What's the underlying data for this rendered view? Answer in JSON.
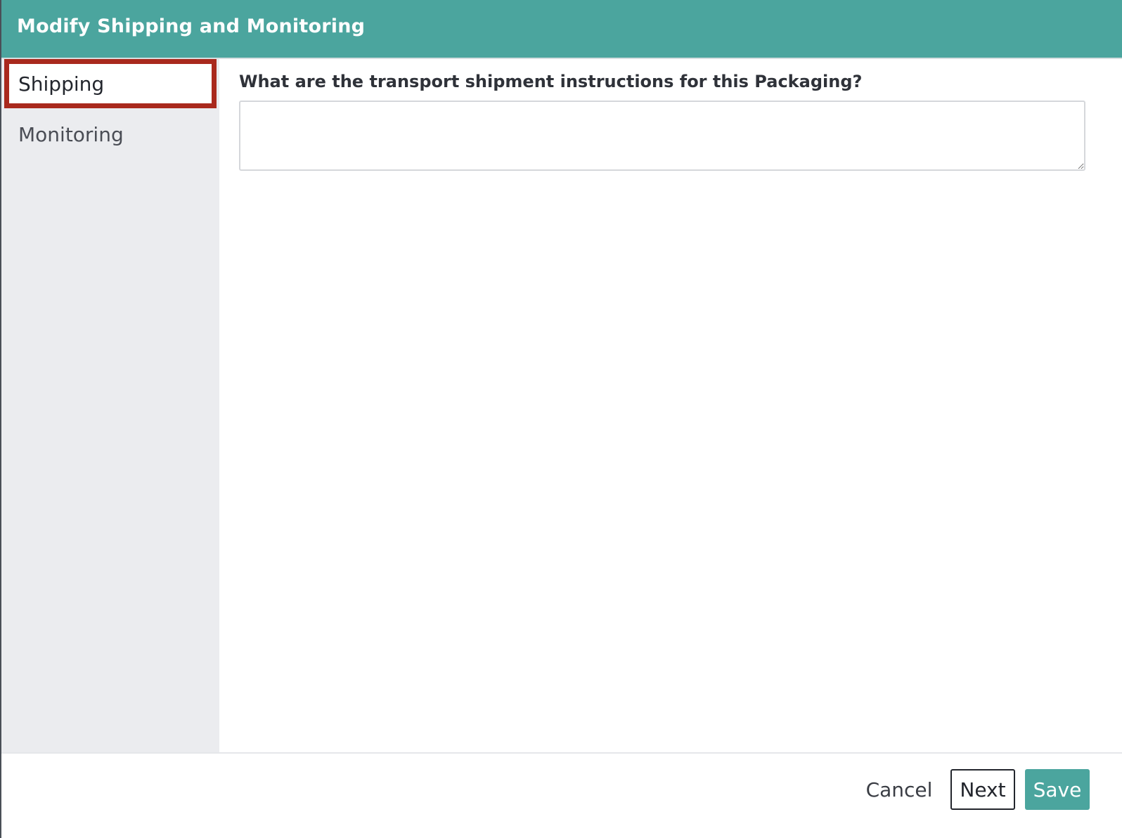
{
  "dialog": {
    "title": "Modify Shipping and Monitoring"
  },
  "sidebar": {
    "items": [
      {
        "label": "Shipping",
        "active": true
      },
      {
        "label": "Monitoring",
        "active": false
      }
    ]
  },
  "main": {
    "question": "What are the transport shipment instructions for this Packaging?",
    "answer_value": ""
  },
  "footer": {
    "cancel_label": "Cancel",
    "next_label": "Next",
    "save_label": "Save"
  },
  "colors": {
    "header_bg": "#4ba59e",
    "active_nav_border": "#a9291d",
    "sidebar_bg": "#ebecef",
    "save_button_bg": "#4ba59e"
  }
}
